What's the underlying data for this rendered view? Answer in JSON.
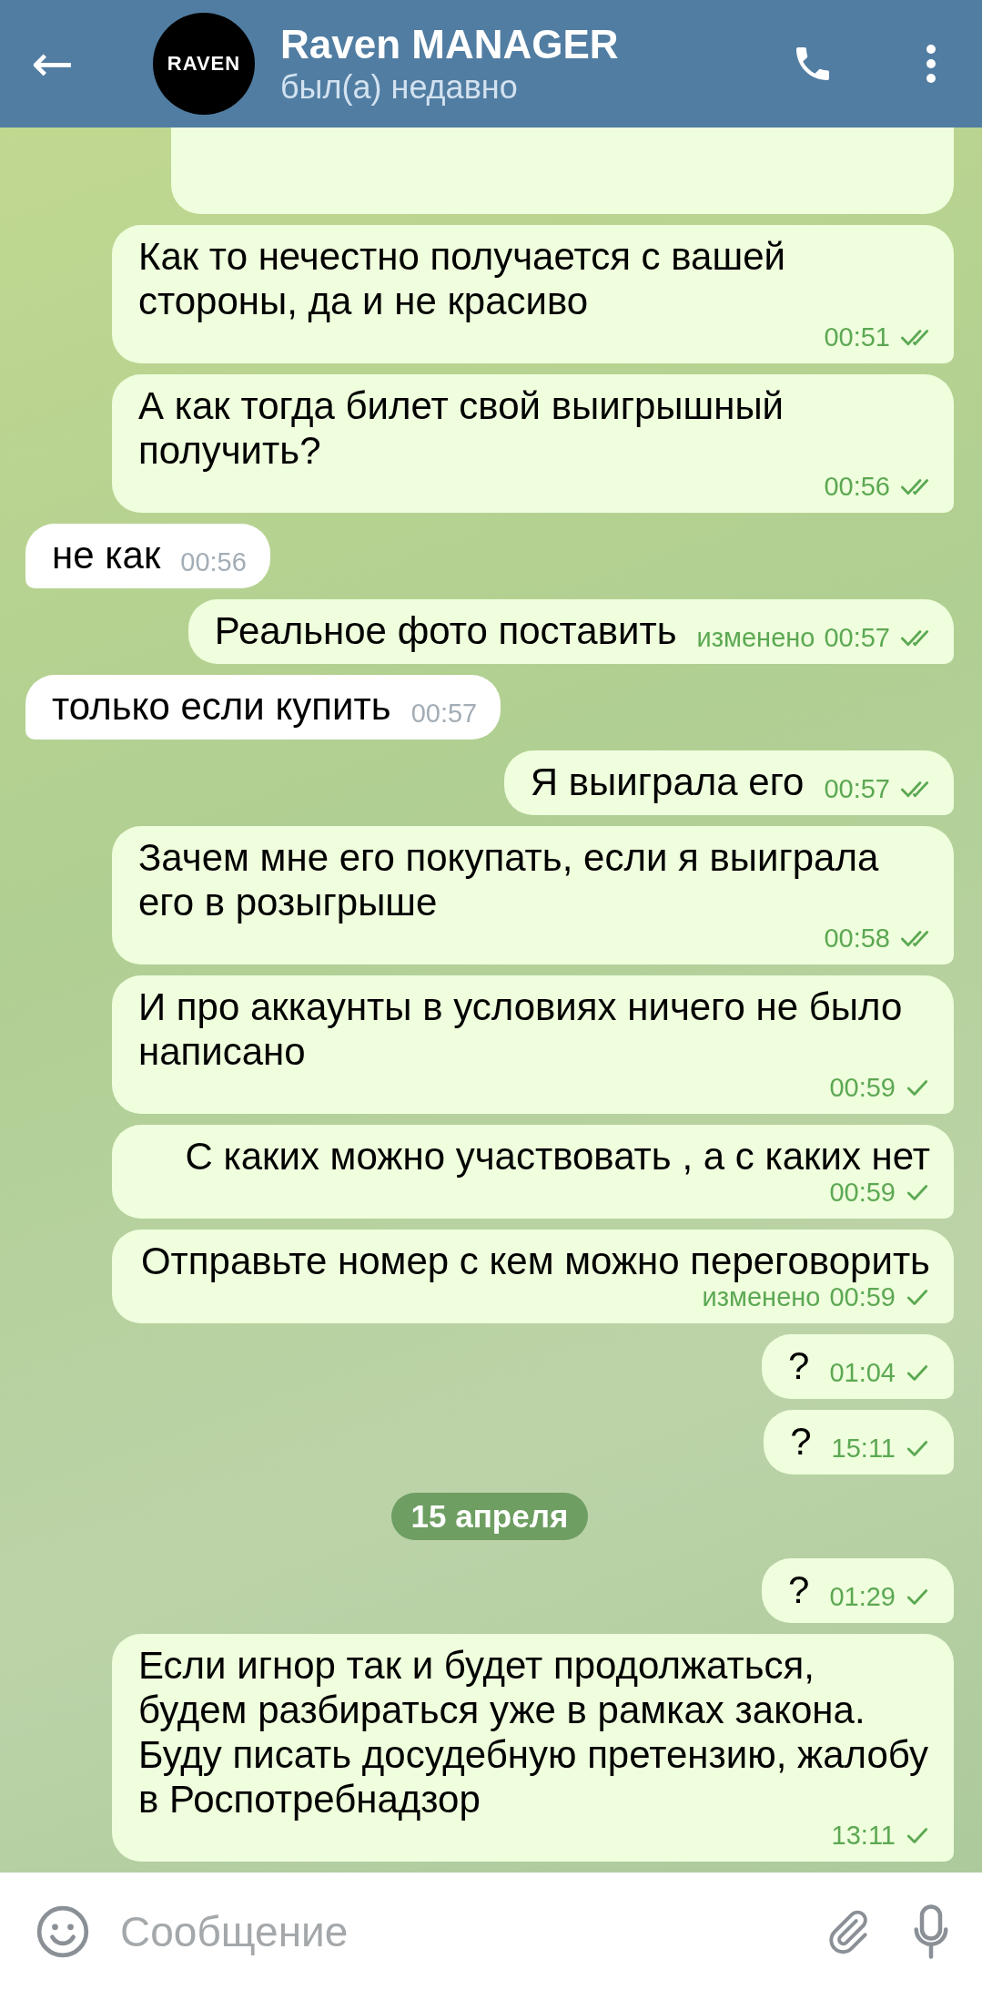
{
  "header": {
    "back": "←",
    "avatar_text": "RAVEN",
    "title": "Raven MANAGER",
    "status": "был(а) недавно"
  },
  "messages": [
    {
      "kind": "partial"
    },
    {
      "kind": "out",
      "text": "Как то нечестно получается с вашей стороны, да и не красиво",
      "time": "00:51",
      "read": true
    },
    {
      "kind": "out",
      "text": "А как тогда билет свой выигрышный получить?",
      "time": "00:56",
      "read": true
    },
    {
      "kind": "in",
      "text": "не как",
      "time": "00:56"
    },
    {
      "kind": "out",
      "text": "Реальное фото поставить",
      "edited_label": "изменено",
      "time": "00:57",
      "read": true
    },
    {
      "kind": "in",
      "text": "только если купить",
      "time": "00:57"
    },
    {
      "kind": "out",
      "text": "Я выиграла его",
      "time": "00:57",
      "read": true
    },
    {
      "kind": "out",
      "text": "Зачем мне его покупать, если я выиграла его в розыгрыше",
      "time": "00:58",
      "read": true
    },
    {
      "kind": "out",
      "text": "И про аккаунты в условиях ничего не было написано",
      "time": "00:59",
      "read": false
    },
    {
      "kind": "out",
      "text": "С каких можно участвовать , а с каких нет",
      "time": "00:59",
      "read": false
    },
    {
      "kind": "out",
      "text": "Отправьте номер с кем можно переговорить",
      "edited_label": "изменено",
      "time": "00:59",
      "read": false
    },
    {
      "kind": "out",
      "text": "?",
      "time": "01:04",
      "read": false
    },
    {
      "kind": "out",
      "text": "?",
      "time": "15:11",
      "read": false
    },
    {
      "kind": "date",
      "text": "15 апреля"
    },
    {
      "kind": "out",
      "text": "?",
      "time": "01:29",
      "read": false
    },
    {
      "kind": "out",
      "text": "Если игнор так и будет продолжаться, будем разбираться уже в рамках закона. Буду писать досудебную претензию, жалобу в Роспотребнадзор",
      "time": "13:11",
      "read": false
    }
  ],
  "composer": {
    "placeholder": "Сообщение"
  }
}
